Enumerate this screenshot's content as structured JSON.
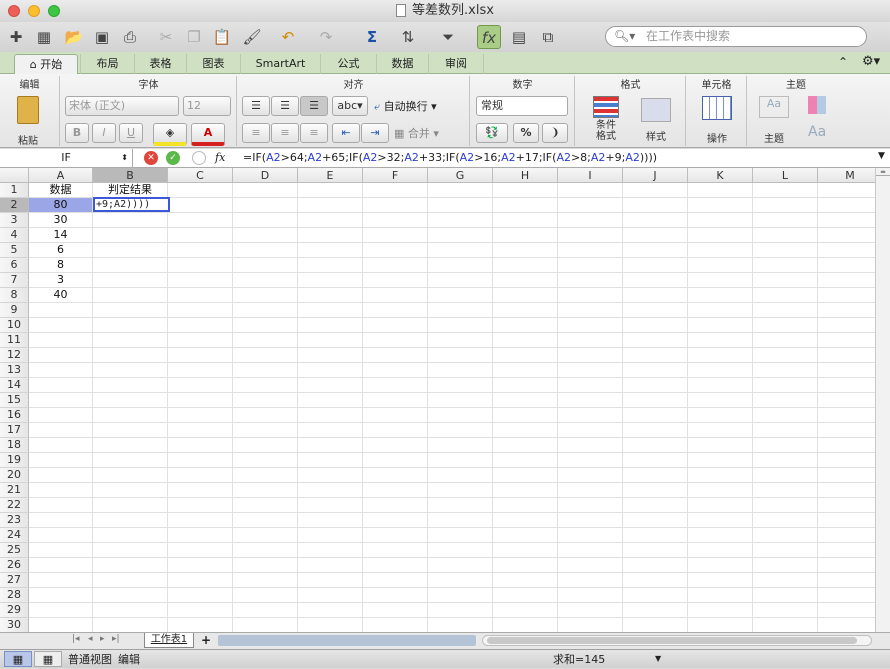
{
  "window": {
    "title": "等差数列.xlsx"
  },
  "toolbar": {
    "search_placeholder": "在工作表中搜索"
  },
  "tabs": [
    "开始",
    "布局",
    "表格",
    "图表",
    "SmartArt",
    "公式",
    "数据",
    "审阅"
  ],
  "ribbon": {
    "edit_group": "编辑",
    "paste": "粘贴",
    "font_group": "字体",
    "font_name": "宋体 (正文)",
    "font_size": "12",
    "bold": "B",
    "italic": "I",
    "underline": "U",
    "align_group": "对齐",
    "abc": "abc",
    "wrap": "自动换行",
    "merge": "合并",
    "number_group": "数字",
    "number_format": "常规",
    "percent": "%",
    "comma": "❩",
    "format_group": "格式",
    "cond_format_1": "条件",
    "cond_format_2": "格式",
    "styles": "样式",
    "cells_group": "单元格",
    "actions": "操作",
    "theme_group": "主题",
    "themes": "主题",
    "aa1": "Aa",
    "aa2": "Aa"
  },
  "formula_bar": {
    "name_box": "IF",
    "fx": "fx",
    "formula": [
      {
        "t": "=IF(",
        "r": false
      },
      {
        "t": "A2",
        "r": true
      },
      {
        "t": ">64;",
        "r": false
      },
      {
        "t": "A2",
        "r": true
      },
      {
        "t": "+65;IF(",
        "r": false
      },
      {
        "t": "A2",
        "r": true
      },
      {
        "t": ">32;",
        "r": false
      },
      {
        "t": "A2",
        "r": true
      },
      {
        "t": "+33;IF(",
        "r": false
      },
      {
        "t": "A2",
        "r": true
      },
      {
        "t": ">16;",
        "r": false
      },
      {
        "t": "A2",
        "r": true
      },
      {
        "t": "+17;IF(",
        "r": false
      },
      {
        "t": "A2",
        "r": true
      },
      {
        "t": ">8;",
        "r": false
      },
      {
        "t": "A2",
        "r": true
      },
      {
        "t": "+9;",
        "r": false
      },
      {
        "t": "A2",
        "r": true
      },
      {
        "t": "))))",
        "r": false
      }
    ]
  },
  "sheet": {
    "columns": [
      "A",
      "B",
      "C",
      "D",
      "E",
      "F",
      "G",
      "H",
      "I",
      "J",
      "K",
      "L",
      "M"
    ],
    "row_count": 30,
    "cells": [
      {
        "row": 1,
        "col": 0,
        "v": "数据"
      },
      {
        "row": 1,
        "col": 1,
        "v": "判定结果"
      },
      {
        "row": 2,
        "col": 0,
        "v": "80"
      },
      {
        "row": 3,
        "col": 0,
        "v": "30"
      },
      {
        "row": 4,
        "col": 0,
        "v": "14"
      },
      {
        "row": 5,
        "col": 0,
        "v": "6"
      },
      {
        "row": 6,
        "col": 0,
        "v": "8"
      },
      {
        "row": 7,
        "col": 0,
        "v": "3"
      },
      {
        "row": 8,
        "col": 0,
        "v": "40"
      }
    ],
    "edit_text": "+9;A2))))",
    "sheet_tab": "工作表1",
    "add_sheet": "+"
  },
  "status": {
    "view": "普通视图",
    "mode": "编辑",
    "sum": "求和=145"
  }
}
